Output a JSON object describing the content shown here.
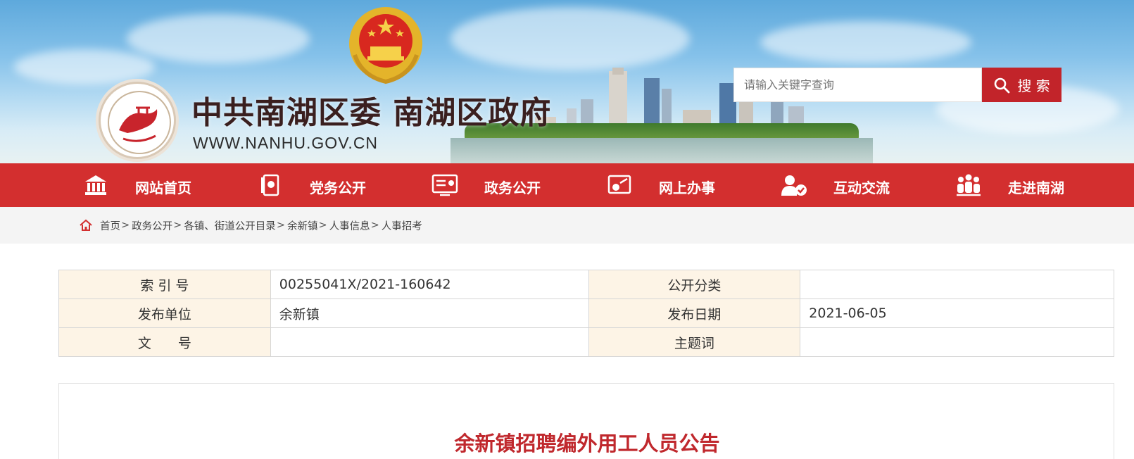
{
  "header": {
    "site_title": "中共南湖区委 南湖区政府",
    "site_url": "WWW.NANHU.GOV.CN",
    "logo_icon": "nanhu-logo-icon",
    "emblem_icon": "national-emblem-icon"
  },
  "search": {
    "placeholder": "请输入关键字查询",
    "button_label": "搜 索",
    "icon": "search-icon"
  },
  "nav": {
    "items": [
      {
        "label": "网站首页",
        "icon": "home-building-icon"
      },
      {
        "label": "党务公开",
        "icon": "party-book-icon"
      },
      {
        "label": "政务公开",
        "icon": "board-icon"
      },
      {
        "label": "网上办事",
        "icon": "desk-icon"
      },
      {
        "label": "互动交流",
        "icon": "user-chat-icon"
      },
      {
        "label": "走进南湖",
        "icon": "people-icon"
      }
    ]
  },
  "breadcrumb": {
    "icon": "home-icon",
    "items": [
      "首页",
      "政务公开",
      "各镇、街道公开目录",
      "余新镇",
      "人事信息",
      "人事招考"
    ],
    "separator": ">"
  },
  "meta": {
    "index_label": "索 引 号",
    "index_value": "00255041X/2021-160642",
    "category_label": "公开分类",
    "category_value": "",
    "publisher_label": "发布单位",
    "publisher_value": "余新镇",
    "date_label": "发布日期",
    "date_value": "2021-06-05",
    "doc_no_label": "文　　号",
    "doc_no_value": "",
    "keywords_label": "主题词",
    "keywords_value": ""
  },
  "article": {
    "title": "余新镇招聘编外用工人员公告"
  },
  "colors": {
    "brand_red": "#d32f2f",
    "search_red": "#c2242a",
    "title_red": "#c0282d",
    "label_bg": "#fdf4e6"
  }
}
